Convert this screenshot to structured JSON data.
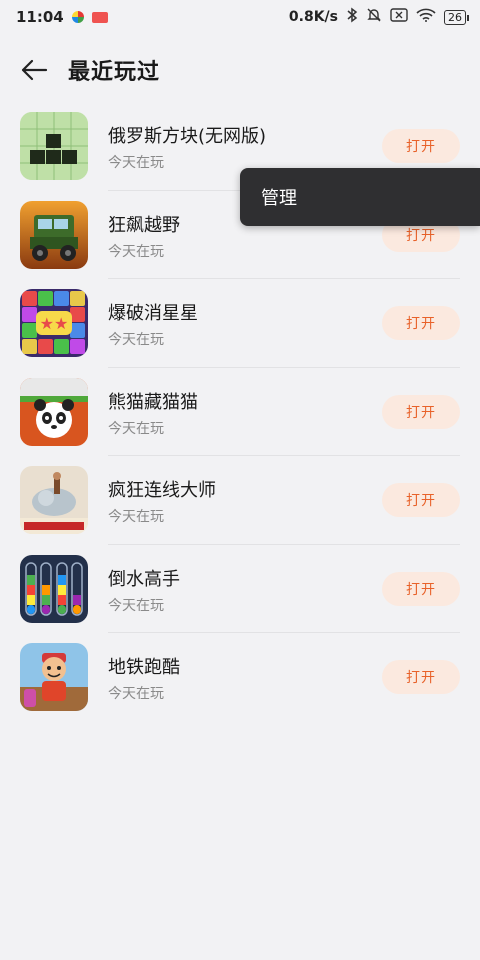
{
  "status": {
    "time": "11:04",
    "speed": "0.8K/s",
    "battery": "26"
  },
  "header": {
    "title": "最近玩过"
  },
  "games": [
    {
      "name": "俄罗斯方块(无网版)",
      "sub": "今天在玩",
      "button": "打开",
      "icon": "tetris-icon"
    },
    {
      "name": "狂飙越野",
      "sub": "今天在玩",
      "button": "打开",
      "icon": "offroad-truck-icon"
    },
    {
      "name": "爆破消星星",
      "sub": "今天在玩",
      "button": "打开",
      "icon": "pop-stars-icon"
    },
    {
      "name": "熊猫藏猫猫",
      "sub": "今天在玩",
      "button": "打开",
      "icon": "panda-icon"
    },
    {
      "name": "疯狂连线大师",
      "sub": "今天在玩",
      "button": "打开",
      "icon": "crazy-line-icon"
    },
    {
      "name": "倒水高手",
      "sub": "今天在玩",
      "button": "打开",
      "icon": "water-sort-icon"
    },
    {
      "name": "地铁跑酷",
      "sub": "今天在玩",
      "button": "打开",
      "icon": "subway-runner-icon"
    }
  ],
  "popup": {
    "label": "管理"
  }
}
